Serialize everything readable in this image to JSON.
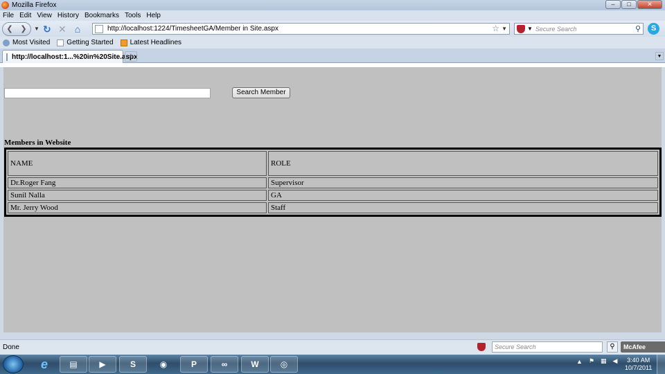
{
  "window": {
    "title": "Mozilla Firefox",
    "controls": {
      "minimize": "–",
      "maximize": "□",
      "close": "✕"
    }
  },
  "menu": [
    "File",
    "Edit",
    "View",
    "History",
    "Bookmarks",
    "Tools",
    "Help"
  ],
  "navbar": {
    "url": "http://localhost:1224/TimesheetGA/Member in Site.aspx",
    "search_placeholder": "Secure Search"
  },
  "bookmarks": [
    "Most Visited",
    "Getting Started",
    "Latest Headlines"
  ],
  "tab": {
    "label": "http://localhost:1...%20in%20Site.aspx",
    "new_tab": "+"
  },
  "page": {
    "search_input_value": "",
    "search_button": "Search Member",
    "section_title": "Members in Website",
    "table": {
      "headers": [
        "NAME",
        "ROLE"
      ],
      "rows": [
        [
          "Dr.Roger Fang",
          "Supervisor"
        ],
        [
          "Sunil Nalla",
          "GA"
        ],
        [
          "Mr. Jerry Wood",
          "Staff"
        ]
      ]
    }
  },
  "statusbar": {
    "text": "Done",
    "search_placeholder": "Secure Search",
    "mcafee": "McAfee"
  },
  "taskbar": {
    "time": "3:40 AM",
    "date": "10/7/2011"
  }
}
